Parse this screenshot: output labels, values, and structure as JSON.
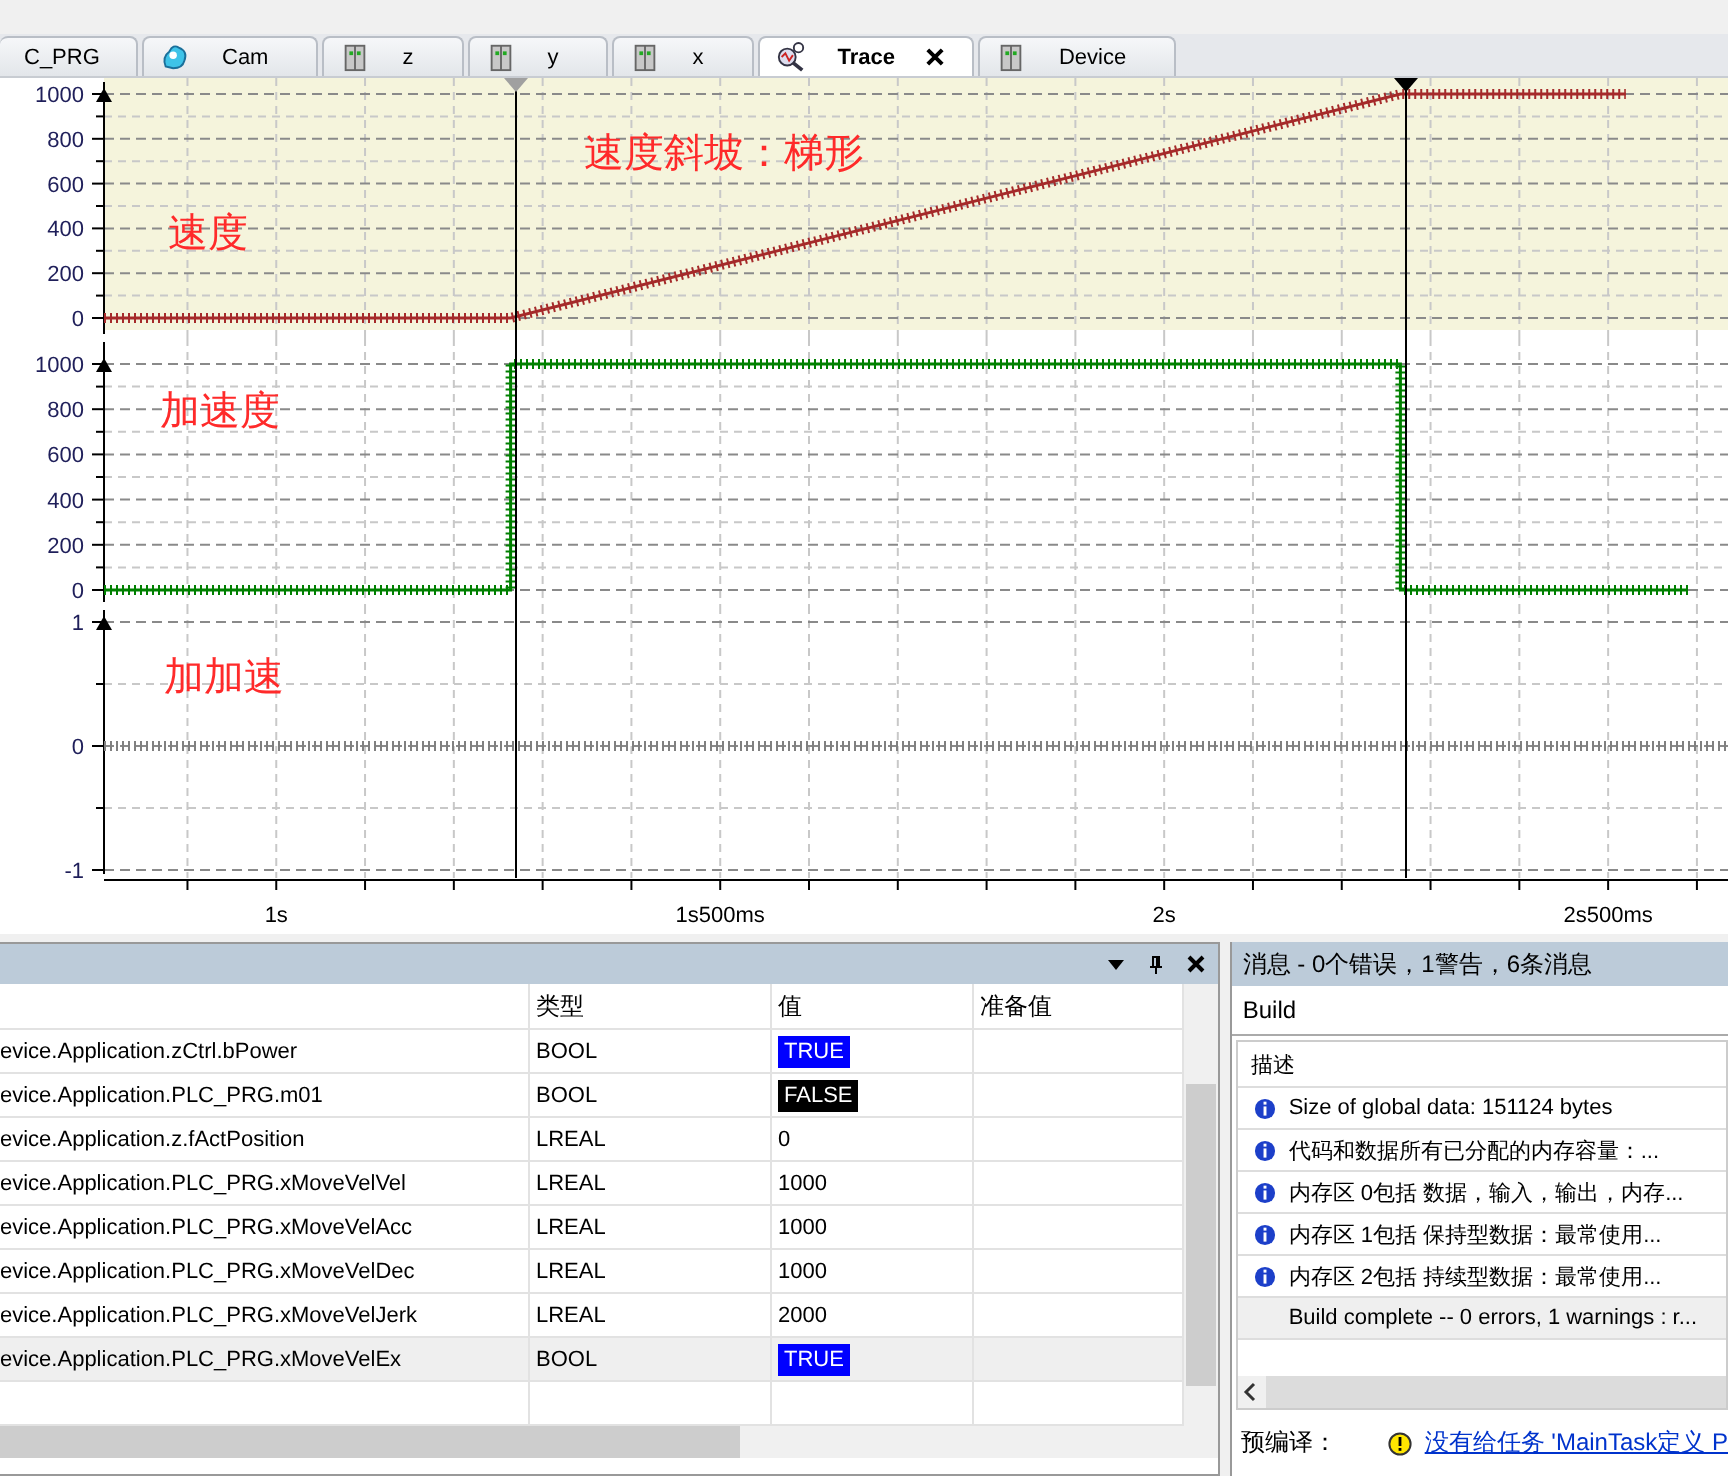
{
  "tabs": [
    {
      "label": "C_PRG",
      "kind": "plain",
      "selected": false
    },
    {
      "label": "Cam",
      "kind": "cam",
      "selected": false
    },
    {
      "label": "z",
      "kind": "device",
      "selected": false
    },
    {
      "label": "y",
      "kind": "device",
      "selected": false
    },
    {
      "label": "x",
      "kind": "device",
      "selected": false
    },
    {
      "label": "Trace",
      "kind": "trace",
      "selected": true
    },
    {
      "label": "Device",
      "kind": "device",
      "selected": false
    }
  ],
  "trace": {
    "panels": [
      {
        "selected": true,
        "chart_data": {
          "type": "line",
          "grid": true,
          "xlim": [
            0.806,
            2.635
          ],
          "ylim": [
            0,
            1000
          ],
          "yticks": [
            0,
            200,
            400,
            600,
            800,
            1000
          ],
          "x": [
            0.806,
            1.264,
            2.266,
            2.52
          ],
          "series": [
            {
              "name": "速度",
              "color": "#a52a2a",
              "values": [
                0,
                0,
                1000,
                1000
              ]
            }
          ],
          "annotations": [
            {
              "text": "速度斜坡：梯形"
            }
          ]
        }
      },
      {
        "selected": false,
        "chart_data": {
          "type": "line",
          "grid": true,
          "xlim": [
            0.806,
            2.635
          ],
          "ylim": [
            0,
            1000
          ],
          "yticks": [
            0,
            200,
            400,
            600,
            800,
            1000
          ],
          "x": [
            0.806,
            1.264,
            1.264,
            2.266,
            2.266,
            2.59
          ],
          "series": [
            {
              "name": "加速度",
              "color": "#008000",
              "values": [
                0,
                0,
                1000,
                1000,
                0,
                0
              ]
            }
          ]
        }
      },
      {
        "selected": false,
        "chart_data": {
          "type": "line",
          "grid": true,
          "xlim": [
            0.806,
            2.635
          ],
          "ylim": [
            -1,
            1
          ],
          "yticks": [
            -1,
            0,
            1
          ],
          "xticks": [
            {
              "value": 1,
              "label": "1s"
            },
            {
              "value": 1.5,
              "label": "1s500ms"
            },
            {
              "value": 2,
              "label": "2s"
            },
            {
              "value": 2.5,
              "label": "2s500ms"
            }
          ],
          "x": [
            0.806,
            2.635
          ],
          "series": [
            {
              "name": "加加速",
              "color": "#808080",
              "line_style": "dashed",
              "values": [
                0,
                0
              ]
            }
          ]
        }
      }
    ]
  },
  "watch": {
    "columns": [
      "类型",
      "值",
      "准备值"
    ],
    "rows": [
      {
        "expression": "evice.Application.zCtrl.bPower",
        "type": "BOOL",
        "value": "TRUE",
        "color": "#0000ff",
        "selected": false
      },
      {
        "expression": "evice.Application.PLC_PRG.m01",
        "type": "BOOL",
        "value": "FALSE",
        "color": "#000000",
        "selected": false
      },
      {
        "expression": "evice.Application.z.fActPosition",
        "type": "LREAL",
        "value": "0",
        "selected": false
      },
      {
        "expression": "evice.Application.PLC_PRG.xMoveVelVel",
        "type": "LREAL",
        "value": "1000",
        "selected": false
      },
      {
        "expression": "evice.Application.PLC_PRG.xMoveVelAcc",
        "type": "LREAL",
        "value": "1000",
        "selected": false
      },
      {
        "expression": "evice.Application.PLC_PRG.xMoveVelDec",
        "type": "LREAL",
        "value": "1000",
        "selected": false
      },
      {
        "expression": "evice.Application.PLC_PRG.xMoveVelJerk",
        "type": "LREAL",
        "value": "2000",
        "selected": false
      },
      {
        "expression": "evice.Application.PLC_PRG.xMoveVelEx",
        "type": "BOOL",
        "value": "TRUE",
        "color": "#0000ff",
        "selected": true
      }
    ]
  },
  "messages": {
    "title": "消息 - 0个错误，1警告，6条消息",
    "filter": "Build",
    "column": "描述",
    "items": [
      {
        "kind": "info",
        "text": "Size of global data: 151124 bytes",
        "selected": false
      },
      {
        "kind": "info",
        "text": "代码和数据所有已分配的内存容量：...",
        "selected": false
      },
      {
        "kind": "info",
        "text": "内存区 0包括 数据，输入，输出，内存...",
        "selected": false
      },
      {
        "kind": "info",
        "text": "内存区 1包括 保持型数据：最常使用...",
        "selected": false
      },
      {
        "kind": "info",
        "text": "内存区 2包括 持续型数据：最常使用...",
        "selected": false
      },
      {
        "kind": "plain",
        "text": "Build complete -- 0 errors, 1 warnings : r...",
        "selected": true
      }
    ],
    "footer": {
      "label": "预编译：",
      "link": "没有给任务 'MainTask定义 P"
    }
  }
}
